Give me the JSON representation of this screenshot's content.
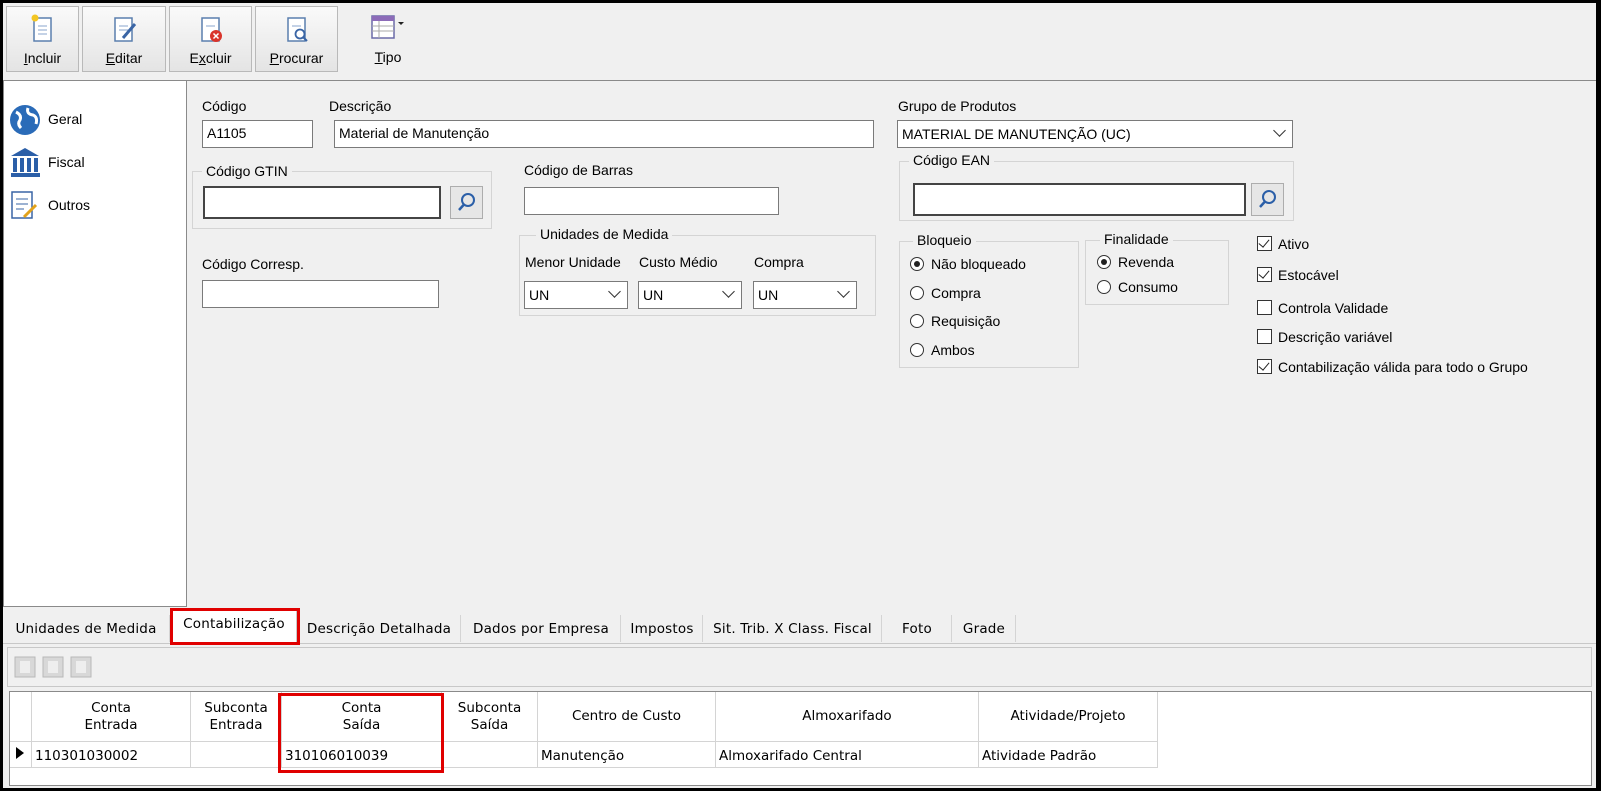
{
  "toolbar": {
    "incluir": "Incluir",
    "editar": "Editar",
    "excluir": "Excluir",
    "procurar": "Procurar",
    "tipo": "Tipo"
  },
  "nav": [
    {
      "label": "Geral",
      "icon": "globe-icon"
    },
    {
      "label": "Fiscal",
      "icon": "bank-icon"
    },
    {
      "label": "Outros",
      "icon": "document-edit-icon"
    }
  ],
  "form": {
    "codigo_label": "Código",
    "codigo_value": "A1105",
    "descricao_label": "Descrição",
    "descricao_value": "Material de Manutenção",
    "grupo_label": "Grupo de Produtos",
    "grupo_value": "MATERIAL DE MANUTENÇÃO (UC)",
    "gtin_label": "Código GTIN",
    "gtin_value": "",
    "barras_label": "Código de Barras",
    "barras_value": "",
    "ean_label": "Código EAN",
    "ean_value": "",
    "corresp_label": "Código Corresp.",
    "corresp_value": "",
    "unidades_title": "Unidades de Medida",
    "menor_label": "Menor Unidade",
    "menor_value": "UN",
    "custo_label": "Custo Médio",
    "custo_value": "UN",
    "compra_label": "Compra",
    "compra_value": "UN"
  },
  "bloqueio": {
    "title": "Bloqueio",
    "options": [
      "Não bloqueado",
      "Compra",
      "Requisição",
      "Ambos"
    ],
    "selected": "Não bloqueado"
  },
  "finalidade": {
    "title": "Finalidade",
    "options": [
      "Revenda",
      "Consumo"
    ],
    "selected": "Revenda"
  },
  "checks": [
    {
      "label": "Ativo",
      "checked": true
    },
    {
      "label": "Estocável",
      "checked": true
    },
    {
      "label": "Controla Validade",
      "checked": false
    },
    {
      "label": "Descrição variável",
      "checked": false
    },
    {
      "label": "Contabilização válida para todo o Grupo",
      "checked": true
    }
  ],
  "tabs": [
    "Unidades de Medida",
    "Contabilização",
    "Descrição Detalhada",
    "Dados por Empresa",
    "Impostos",
    "Sit. Trib. X Class. Fiscal",
    "Foto",
    "Grade"
  ],
  "active_tab": "Contabilização",
  "grid": {
    "headers": [
      [
        "Conta",
        "Entrada"
      ],
      [
        "Subconta",
        "Entrada"
      ],
      [
        "Conta",
        "Saída"
      ],
      [
        "Subconta",
        "Saída"
      ],
      [
        "Centro de Custo"
      ],
      [
        "Almoxarifado"
      ],
      [
        "Atividade/Projeto"
      ]
    ],
    "rows": [
      [
        "110301030002",
        "",
        "310106010039",
        "",
        "Manutenção",
        "Almoxarifado Central",
        "Atividade Padrão"
      ]
    ]
  },
  "colors": {
    "highlight": "#e00000"
  }
}
